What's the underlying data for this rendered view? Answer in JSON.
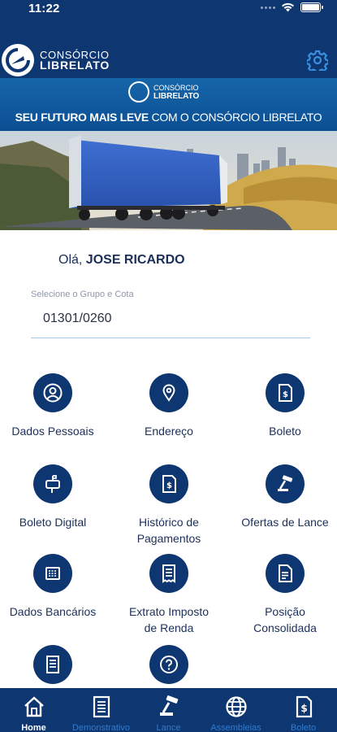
{
  "status_bar": {
    "time": "11:22"
  },
  "app_bar": {
    "logo_line1": "CONSÓRCIO",
    "logo_line2": "LIBRELATO",
    "settings_icon": "gear-icon"
  },
  "banner": {
    "logo_line1": "CONSÓRCIO",
    "logo_line2": "LIBRELATO",
    "slogan_bold": "SEU FUTURO MAIS LEVE",
    "slogan_rest": " COM O CONSÓRCIO LIBRELATO"
  },
  "greeting": {
    "prefix": "Olá,",
    "name": "JOSE RICARDO"
  },
  "group_select": {
    "label": "Selecione o Grupo e Cota",
    "value": "01301/0260"
  },
  "menu": [
    {
      "label": "Dados Pessoais",
      "icon": "user-icon"
    },
    {
      "label": "Endereço",
      "icon": "location-pin-icon"
    },
    {
      "label": "Boleto",
      "icon": "boleto-icon"
    },
    {
      "label": "Boleto Digital",
      "icon": "mailbox-icon"
    },
    {
      "label": "Histórico de Pagamentos",
      "icon": "payment-history-icon"
    },
    {
      "label": "Ofertas de Lance",
      "icon": "gavel-icon"
    },
    {
      "label": "Dados Bancários",
      "icon": "bank-icon"
    },
    {
      "label": "Extrato Imposto de Renda",
      "icon": "receipt-icon"
    },
    {
      "label": "Posição Consolidada",
      "icon": "document-icon"
    },
    {
      "label": "",
      "icon": "statement-icon"
    },
    {
      "label": "",
      "icon": "help-icon"
    }
  ],
  "tabs": [
    {
      "label": "Home",
      "icon": "home-icon",
      "active": true
    },
    {
      "label": "Demonstrativo",
      "icon": "statement-icon",
      "active": false
    },
    {
      "label": "Lance",
      "icon": "gavel-icon",
      "active": false
    },
    {
      "label": "Assembleias",
      "icon": "globe-icon",
      "active": false
    },
    {
      "label": "Boleto",
      "icon": "boleto-icon",
      "active": false
    }
  ],
  "colors": {
    "primary": "#0e3671",
    "accent": "#2f7ccf",
    "text": "#1b2f59"
  }
}
